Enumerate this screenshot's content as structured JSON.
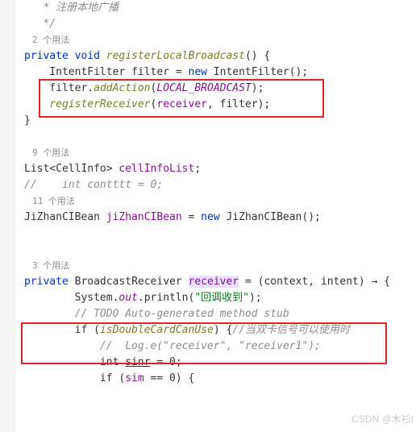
{
  "comment_block": {
    "line1": "   * 注册本地广播",
    "line2": "   */"
  },
  "usages": {
    "u2": "2 个用法",
    "u9": "9 个用法",
    "u11": "11 个用法",
    "u3": "3 个用法"
  },
  "method1": {
    "sig_pre": "private void ",
    "name": "registerLocalBroadcast",
    "sig_post": "() {",
    "l1_pre": "    IntentFilter filter = ",
    "l1_new": "new",
    "l1_post": " IntentFilter();",
    "l2_pre": "    filter.",
    "l2_m": "addAction",
    "l2_open": "(",
    "l2_const": "LOCAL_BROADCAST",
    "l2_close": ");",
    "l3_pre": "    ",
    "l3_m": "registerReceiver",
    "l3_open": "(",
    "l3_arg1": "receiver",
    "l3_sep": ", filter);",
    "close": "}"
  },
  "decl1": {
    "pre": "List<CellInfo> ",
    "name": "cellInfoList",
    "post": ";"
  },
  "comment2": "//    int contttt = 0;",
  "decl2": {
    "pre": "JiZhanCIBean ",
    "name": "jiZhanCIBean",
    "mid": " = ",
    "new": "new",
    "post": " JiZhanCIBean();"
  },
  "receiver": {
    "pre": "private",
    "type": " BroadcastReceiver ",
    "name": "receiver",
    "mid": " = (context, intent) → {",
    "l1_pre": "        System.",
    "l1_out": "out",
    "l1_m": ".println(",
    "l1_str": "\"回调收到\"",
    "l1_post": ");",
    "todo": "        // TODO Auto-generated method stub",
    "if1_pre": "        if (",
    "if1_m": "isDoubleCardCanUse",
    "if1_post": ") {",
    "if1_cmt": "//当双卡信号可以使用时",
    "log_cmt": "            //  Log.e(\"receiver\", \"receiver1\");",
    "sinr_pre": "            int ",
    "sinr_name": "sinr",
    "sinr_post": " = 0;",
    "if2_pre": "            if (",
    "if2_var": "sim",
    "if2_post": " == 0) {"
  },
  "watermark": "CSDN @木衫I"
}
